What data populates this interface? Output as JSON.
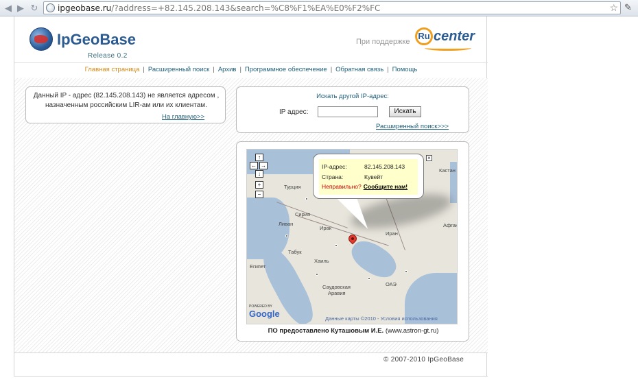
{
  "browser": {
    "url_host": "ipgeobase.ru",
    "url_rest": "/?address=+82.145.208.143&search=%C8%F1%EA%E0%F2%FC"
  },
  "header": {
    "logo_text": "IpGeoBase",
    "release": "Release 0.2",
    "support_text": "При поддержке",
    "rucenter_circle": "Ru",
    "rucenter_text": "center"
  },
  "menu": {
    "items": [
      {
        "label": "Главная страница",
        "active": true
      },
      {
        "label": "Расширенный поиск"
      },
      {
        "label": "Архив"
      },
      {
        "label": "Программное обеспечение"
      },
      {
        "label": "Обратная связь"
      },
      {
        "label": "Помощь"
      }
    ]
  },
  "notice": {
    "message": "Данный IP - адрес (82.145.208.143) не является адресом , назначенным российским LIR-ам или их клиентам.",
    "home_link": "На главную>>"
  },
  "search": {
    "title": "Искать другой IP-адрес:",
    "ip_label": "IP адрес:",
    "ip_value": "",
    "button": "Искать",
    "advanced_link": "Расширенный поиск>>>"
  },
  "map": {
    "popup": {
      "ip_label": "IP-адрес:",
      "ip_value": "82.145.208.143",
      "country_label": "Страна:",
      "country_value": "Кувейт",
      "wrong": "Неправильно?",
      "report": "Сообщите нам!"
    },
    "labels": {
      "turkey": "Турция",
      "syria": "Сирия",
      "lebanon": "Ливан",
      "iraq": "Ирак",
      "iran": "Иран",
      "afghan": "Афгани",
      "egypt": "Египет",
      "saudi1": "Саудовская",
      "saudi2": "Аравия",
      "uae": "ОАЭ",
      "kz": "Кастан",
      "tabuk": "Табук",
      "hail": "Хаиль"
    },
    "powered": "POWERED BY",
    "google": "Google",
    "terms": "Данные карты ©2010 - Условия использования"
  },
  "credit": {
    "prefix": "ПО предоставлено Куташовым И.Е.",
    "site": "(www.astron-gt.ru)"
  },
  "footer": {
    "copyright": "© 2007-2010 IpGeoBase"
  }
}
